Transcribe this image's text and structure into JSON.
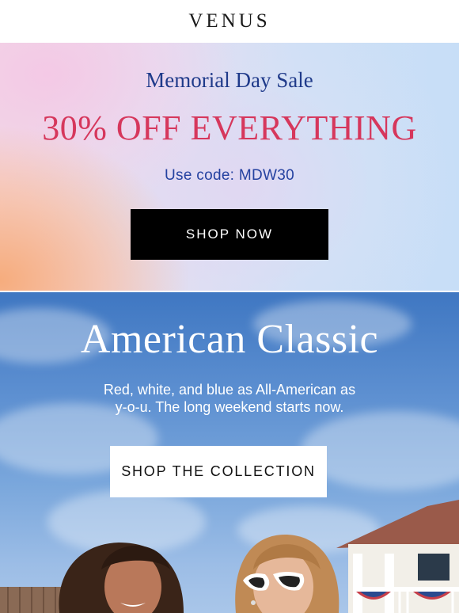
{
  "header": {
    "logo_text": "VENUS"
  },
  "sale_banner": {
    "title": "Memorial Day Sale",
    "headline": "30% OFF EVERYTHING",
    "code_text": "Use code: MDW30",
    "button_label": "SHOP NOW"
  },
  "hero_banner": {
    "title": "American Classic",
    "subtitle_line1": "Red, white, and blue as All-American as",
    "subtitle_line2": "y-o-u. The long weekend starts now.",
    "button_label": "SHOP THE COLLECTION"
  },
  "colors": {
    "sale_title": "#1f3a8a",
    "sale_headline": "#d6375c",
    "code": "#2441a0",
    "button_dark": "#000000",
    "sky": "#5b8ed0"
  }
}
